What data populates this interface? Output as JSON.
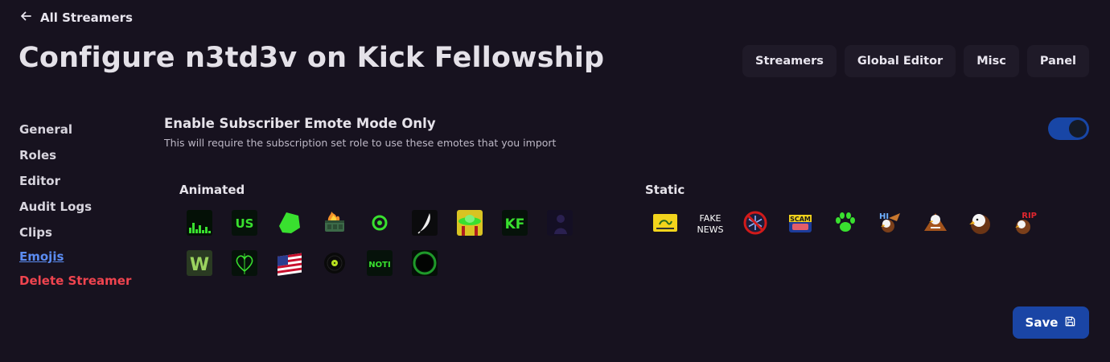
{
  "header": {
    "back_label": "All Streamers",
    "title": "Configure n3td3v on Kick Fellowship"
  },
  "top_nav": [
    {
      "label": "Streamers"
    },
    {
      "label": "Global Editor"
    },
    {
      "label": "Misc"
    },
    {
      "label": "Panel"
    }
  ],
  "sidebar": {
    "items": [
      {
        "label": "General"
      },
      {
        "label": "Roles"
      },
      {
        "label": "Editor"
      },
      {
        "label": "Audit Logs"
      },
      {
        "label": "Clips"
      },
      {
        "label": "Emojis",
        "active": true
      },
      {
        "label": "Delete Streamer",
        "danger": true
      }
    ]
  },
  "setting": {
    "title": "Enable Subscriber Emote Mode Only",
    "description": "This will require the subscription set role to use these emotes that you import",
    "enabled": true
  },
  "animated": {
    "title": "Animated",
    "emotes": [
      {
        "icon": "equalizer-bars-emote"
      },
      {
        "icon": "us-text-emote",
        "text": "US"
      },
      {
        "icon": "green-blob-emote"
      },
      {
        "icon": "burning-dumpster-emote"
      },
      {
        "icon": "green-coin-emote"
      },
      {
        "icon": "white-feather-emote"
      },
      {
        "icon": "green-ufo-emote"
      },
      {
        "icon": "kf-text-emote",
        "text": "KF"
      },
      {
        "icon": "dark-figure-emote"
      },
      {
        "icon": "w-letter-emote",
        "text": "W"
      },
      {
        "icon": "heart-lines-emote"
      },
      {
        "icon": "us-flag-emote"
      },
      {
        "icon": "vinyl-record-emote"
      },
      {
        "icon": "noti-text-emote",
        "text": "NOTI"
      },
      {
        "icon": "green-portal-emote"
      }
    ]
  },
  "static": {
    "title": "Static",
    "emotes": [
      {
        "icon": "gadsden-flag-emote"
      },
      {
        "icon": "fake-news-emote",
        "text": "FAKE NEWS"
      },
      {
        "icon": "no-snowflake-emote"
      },
      {
        "icon": "scam-can-emote",
        "text": "SCAM"
      },
      {
        "icon": "paw-print-emote"
      },
      {
        "icon": "eagle-hi-emote",
        "text": "HI"
      },
      {
        "icon": "eagle-claws-emote"
      },
      {
        "icon": "eagle-head-emote"
      },
      {
        "icon": "eagle-rip-emote",
        "text": "RIP"
      }
    ]
  },
  "save": {
    "label": "Save"
  },
  "colors": {
    "background": "#17121f",
    "accent": "#1a45a5",
    "link": "#5b8cf2",
    "danger": "#f0444f",
    "emote_green": "#39e02f"
  }
}
